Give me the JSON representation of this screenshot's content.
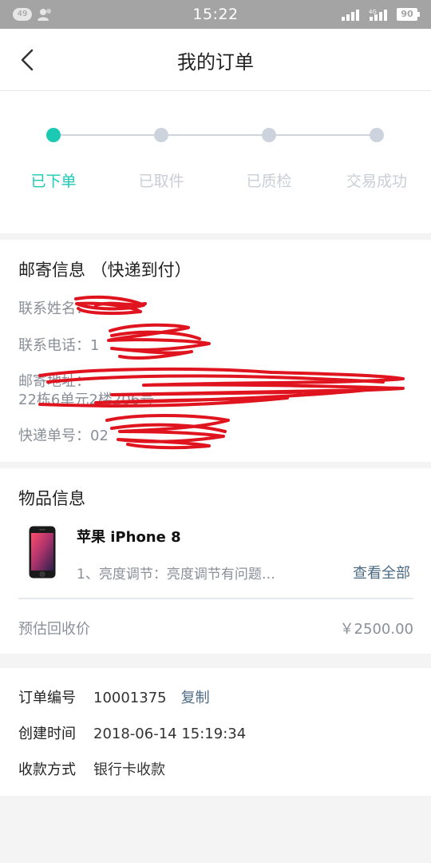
{
  "status_bar": {
    "notification_count": "49",
    "time": "15:22",
    "network_label": "4G",
    "battery": "90"
  },
  "header": {
    "title": "我的订单"
  },
  "progress": {
    "steps": [
      {
        "label": "已下单",
        "active": true
      },
      {
        "label": "已取件",
        "active": false
      },
      {
        "label": "已质检",
        "active": false
      },
      {
        "label": "交易成功",
        "active": false
      }
    ]
  },
  "mail_info": {
    "title": "邮寄信息 （快递到付）",
    "name_label": "联系姓名：",
    "name_value": "",
    "phone_label": "联系电话：",
    "phone_value": "1",
    "address_label": "邮寄地址：",
    "address_line2": "22栋6单元2楼206号",
    "tracking_label": "快递单号：",
    "tracking_value": "02"
  },
  "item_info": {
    "title": "物品信息",
    "product_name": "苹果 iPhone 8",
    "description": "1、亮度调节：亮度调节有问题…",
    "view_all": "查看全部",
    "estimate_label": "预估回收价",
    "estimate_value": "￥2500.00"
  },
  "order_info": {
    "order_no_label": "订单编号",
    "order_no": "10001375",
    "copy_label": "复制",
    "created_label": "创建时间",
    "created_value": "2018-06-14 15:19:34",
    "payment_label": "收款方式",
    "payment_value": "银行卡收款"
  },
  "colors": {
    "accent": "#1ccab4",
    "link": "#4d6b85",
    "inactive": "#cdd3dc",
    "scribble": "#e0141e"
  }
}
